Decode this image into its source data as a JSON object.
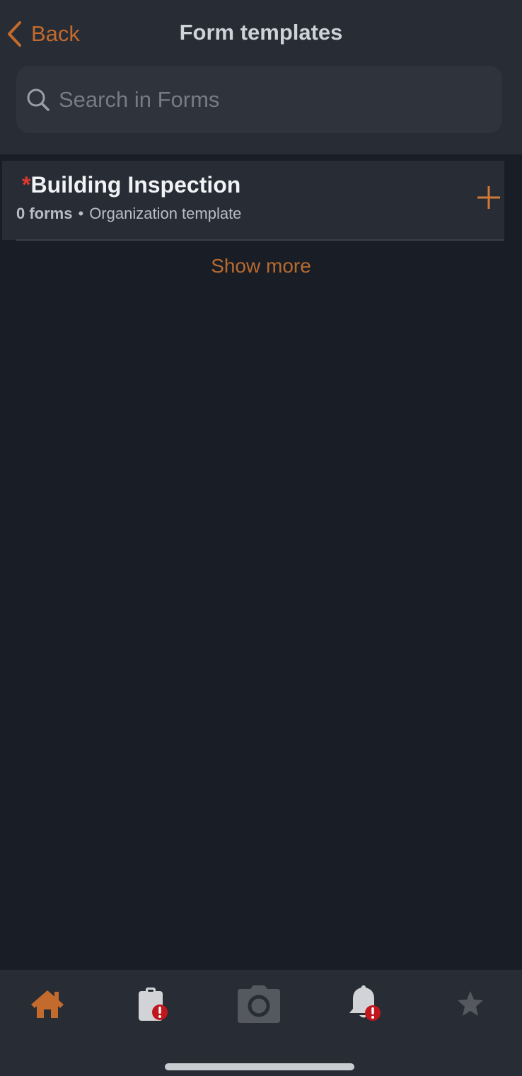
{
  "nav": {
    "back_label": "Back",
    "title": "Form templates"
  },
  "search": {
    "placeholder": "Search in Forms",
    "value": ""
  },
  "templates": [
    {
      "required_mark": "*",
      "name": "Building Inspection",
      "forms_count": "0 forms",
      "separator": "•",
      "type": "Organization template"
    }
  ],
  "show_more_label": "Show more",
  "tabbar": {
    "tabs": [
      {
        "name": "home",
        "icon": "home-icon",
        "active": true
      },
      {
        "name": "forms",
        "icon": "clipboard-alert-icon",
        "active": false
      },
      {
        "name": "camera",
        "icon": "camera-icon",
        "active": false
      },
      {
        "name": "notifications",
        "icon": "bell-alert-icon",
        "active": false
      },
      {
        "name": "favorites",
        "icon": "star-icon",
        "active": false
      }
    ]
  },
  "colors": {
    "accent": "#c36a2d",
    "background": "#181d26",
    "header": "#272c35",
    "alert": "#c0171d",
    "required": "#e03a2f"
  }
}
